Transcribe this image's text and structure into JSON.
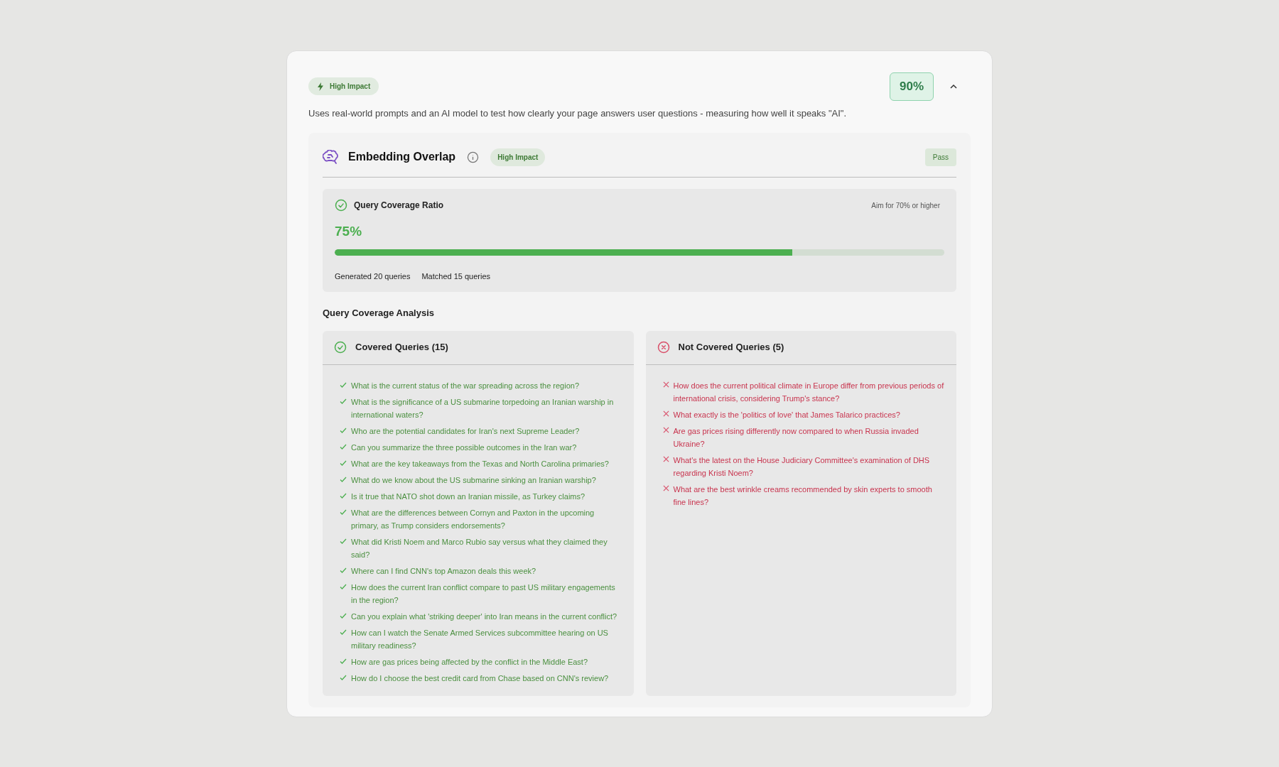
{
  "header": {
    "impact_badge": "High Impact",
    "score": "90%",
    "expanded": true,
    "description": "Uses real-world prompts and an AI model to test how clearly your page answers user questions - measuring how well it speaks \"AI\"."
  },
  "section": {
    "title": "Embedding Overlap",
    "impact_badge": "High Impact",
    "status": "Pass",
    "metric": {
      "title": "Query Coverage Ratio",
      "target": "Aim for 70% or higher",
      "value": "75%",
      "level": 0.75,
      "stats": [
        "Generated 20 queries",
        "Matched 15 queries"
      ]
    },
    "analysis_title": "Query Coverage Analysis",
    "panels": [
      {
        "kind": "covered",
        "title": "Covered Queries (15)",
        "queries": [
          "What is the current status of the war spreading across the region?",
          "What is the significance of a US submarine torpedoing an Iranian warship in international waters?",
          "Who are the potential candidates for Iran's next Supreme Leader?",
          "Can you summarize the three possible outcomes in the Iran war?",
          "What are the key takeaways from the Texas and North Carolina primaries?",
          "What do we know about the US submarine sinking an Iranian warship?",
          "Is it true that NATO shot down an Iranian missile, as Turkey claims?",
          "What are the differences between Cornyn and Paxton in the upcoming primary, as Trump considers endorsements?",
          "What did Kristi Noem and Marco Rubio say versus what they claimed they said?",
          "Where can I find CNN's top Amazon deals this week?",
          "How does the current Iran conflict compare to past US military engagements in the region?",
          "Can you explain what 'striking deeper' into Iran means in the current conflict?",
          "How can I watch the Senate Armed Services subcommittee hearing on US military readiness?",
          "How are gas prices being affected by the conflict in the Middle East?",
          "How do I choose the best credit card from Chase based on CNN's review?"
        ]
      },
      {
        "kind": "not_covered",
        "title": "Not Covered Queries (5)",
        "queries": [
          "How does the current political climate in Europe differ from previous periods of international crisis, considering Trump's stance?",
          "What exactly is the 'politics of love' that James Talarico practices?",
          "Are gas prices rising differently now compared to when Russia invaded Ukraine?",
          "What's the latest on the House Judiciary Committee's examination of DHS regarding Kristi Noem?",
          "What are the best wrinkle creams recommended by skin experts to smooth fine lines?"
        ]
      }
    ]
  }
}
